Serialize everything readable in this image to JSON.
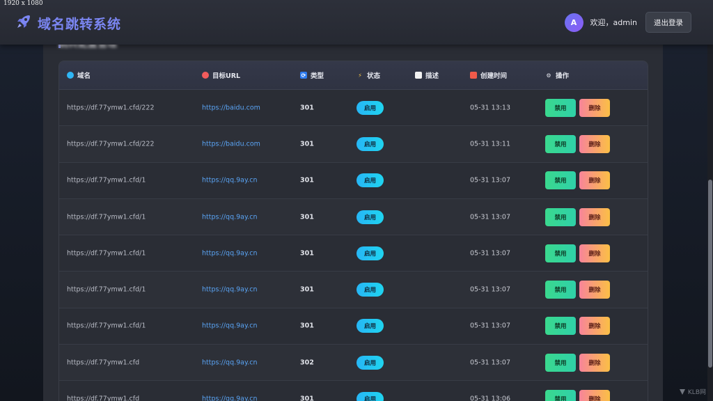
{
  "overlay": {
    "dims": "1920 x 1080"
  },
  "header": {
    "title": "域名跳转系统",
    "welcome": "欢迎，admin",
    "avatar_letter": "A",
    "logout_label": "退出登录"
  },
  "section": {
    "title": "跳转配置管理"
  },
  "table": {
    "columns": [
      {
        "label": "域名",
        "icon": "globe-icon"
      },
      {
        "label": "目标URL",
        "icon": "target-icon"
      },
      {
        "label": "类型",
        "icon": "refresh-icon"
      },
      {
        "label": "状态",
        "icon": "lightning-icon"
      },
      {
        "label": "描述",
        "icon": "memo-icon"
      },
      {
        "label": "创建时间",
        "icon": "calendar-icon"
      },
      {
        "label": "操作",
        "icon": "gear-icon"
      }
    ],
    "rows": [
      {
        "domain": "https://df.77ymw1.cfd/222",
        "url": "https://baidu.com",
        "type": "301",
        "status": "启用",
        "desc": "",
        "time": "05-31 13:13"
      },
      {
        "domain": "https://df.77ymw1.cfd/222",
        "url": "https://baidu.com",
        "type": "301",
        "status": "启用",
        "desc": "",
        "time": "05-31 13:11"
      },
      {
        "domain": "https://df.77ymw1.cfd/1",
        "url": "https://qq.9ay.cn",
        "type": "301",
        "status": "启用",
        "desc": "",
        "time": "05-31 13:07"
      },
      {
        "domain": "https://df.77ymw1.cfd/1",
        "url": "https://qq.9ay.cn",
        "type": "301",
        "status": "启用",
        "desc": "",
        "time": "05-31 13:07"
      },
      {
        "domain": "https://df.77ymw1.cfd/1",
        "url": "https://qq.9ay.cn",
        "type": "301",
        "status": "启用",
        "desc": "",
        "time": "05-31 13:07"
      },
      {
        "domain": "https://df.77ymw1.cfd/1",
        "url": "https://qq.9ay.cn",
        "type": "301",
        "status": "启用",
        "desc": "",
        "time": "05-31 13:07"
      },
      {
        "domain": "https://df.77ymw1.cfd/1",
        "url": "https://qq.9ay.cn",
        "type": "301",
        "status": "启用",
        "desc": "",
        "time": "05-31 13:07"
      },
      {
        "domain": "https://df.77ymw1.cfd",
        "url": "https://qq.9ay.cn",
        "type": "302",
        "status": "启用",
        "desc": "",
        "time": "05-31 13:07"
      },
      {
        "domain": "https://df.77ymw1.cfd",
        "url": "https://qq.9ay.cn",
        "type": "301",
        "status": "启用",
        "desc": "",
        "time": "05-31 13:06"
      }
    ],
    "actions": {
      "disable_label": "禁用",
      "delete_label": "删除"
    }
  },
  "watermark": {
    "text": "KLB网"
  },
  "colors": {
    "accent": "#7b86f2",
    "status": "#27b6f5",
    "disable": "#3ad88e",
    "delete": "#f7849a"
  }
}
